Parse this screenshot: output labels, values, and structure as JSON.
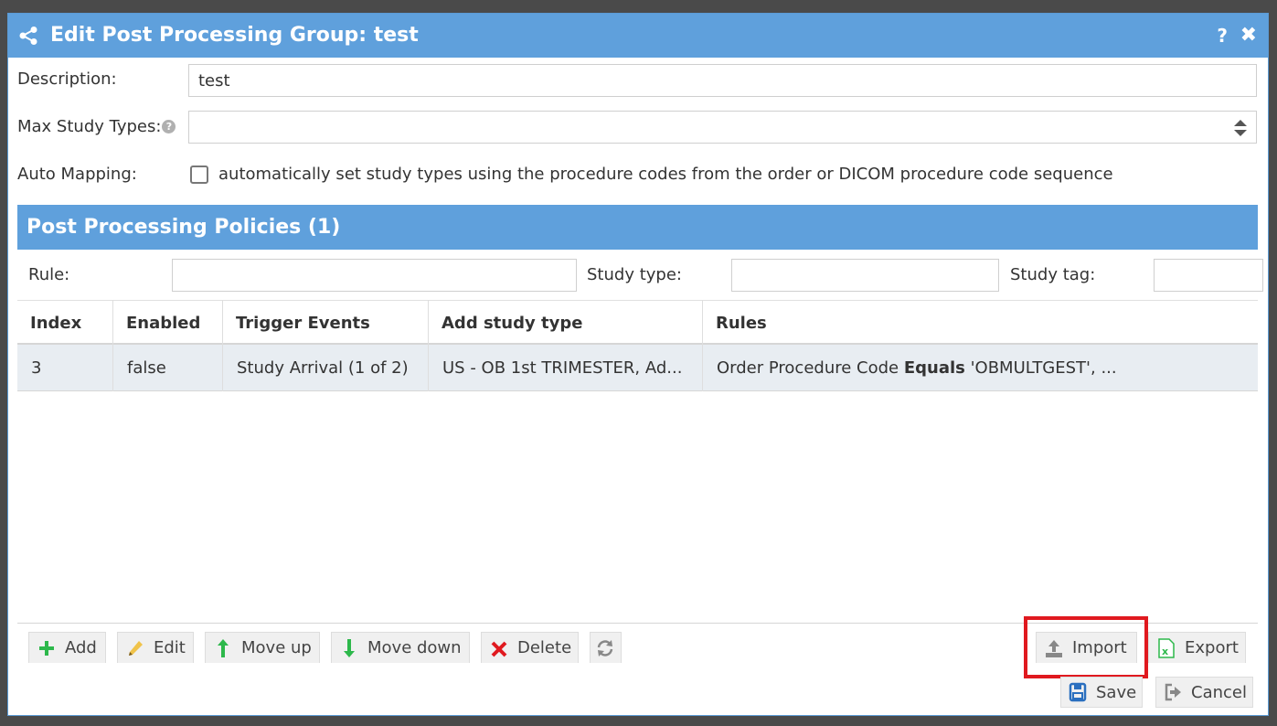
{
  "dialog": {
    "title": "Edit Post Processing Group: test",
    "help_label": "?",
    "close_label": "✖"
  },
  "form": {
    "description_label": "Description:",
    "description_value": "test",
    "max_study_types_label": "Max Study Types:",
    "max_study_types_value": "",
    "auto_mapping_label": "Auto Mapping:",
    "auto_mapping_checked": false,
    "auto_mapping_text": "automatically set study types using the procedure codes from the order or DICOM procedure code sequence"
  },
  "policies": {
    "header": "Post Processing Policies (1)",
    "filters": {
      "rule_label": "Rule:",
      "study_type_label": "Study type:",
      "study_tag_label": "Study tag:"
    },
    "columns": [
      "Index",
      "Enabled",
      "Trigger Events",
      "Add study type",
      "Rules"
    ],
    "rows": [
      {
        "index": "3",
        "enabled": "false",
        "trigger_events": "Study Arrival (1 of 2)",
        "add_study_type": "US - OB 1st TRIMESTER, Ad...",
        "rules_prefix": "Order Procedure Code ",
        "rules_operator": "Equals",
        "rules_suffix": " 'OBMULTGEST', ..."
      }
    ]
  },
  "toolbar": {
    "add_label": "Add",
    "edit_label": "Edit",
    "move_up_label": "Move up",
    "move_down_label": "Move down",
    "delete_label": "Delete",
    "import_label": "Import",
    "export_label": "Export",
    "save_label": "Save",
    "cancel_label": "Cancel"
  },
  "colors": {
    "titlebar": "#5fa0dc",
    "section_header": "#5fa0dc",
    "highlight": "#e0191f",
    "add_icon": "#2db84b",
    "move_icon": "#2db84b",
    "delete_icon": "#e0191f",
    "export_icon": "#2db84b",
    "save_icon": "#2a6fbf"
  }
}
